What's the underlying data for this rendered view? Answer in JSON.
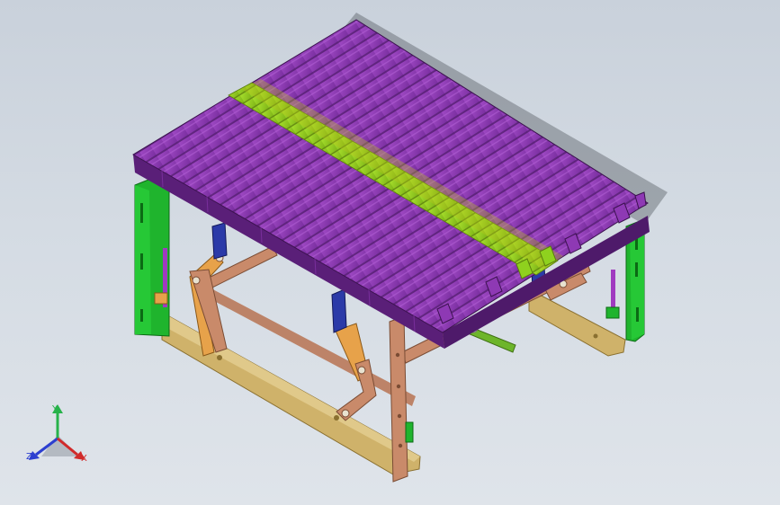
{
  "viewport": {
    "background_top": "#c9d1db",
    "background_bottom": "#dfe4ea"
  },
  "model": {
    "description_colors": {
      "profile_purple": "#8e39b4",
      "profile_purple_dark": "#5a1f78",
      "profile_green": "#8fd11e",
      "profile_green_dark": "#6b8e12",
      "bracket_green": "#1fb42d",
      "link_orange": "#e7a24a",
      "link_brown": "#c98a6a",
      "base_tan": "#cfb26a",
      "mount_blue": "#2b3aa8"
    }
  },
  "triad": {
    "y_label": "Y",
    "z_label": "Z",
    "x_label": "X",
    "y_color": "#27b24a",
    "z_color": "#2c3fd0",
    "x_color": "#d12a2a"
  }
}
